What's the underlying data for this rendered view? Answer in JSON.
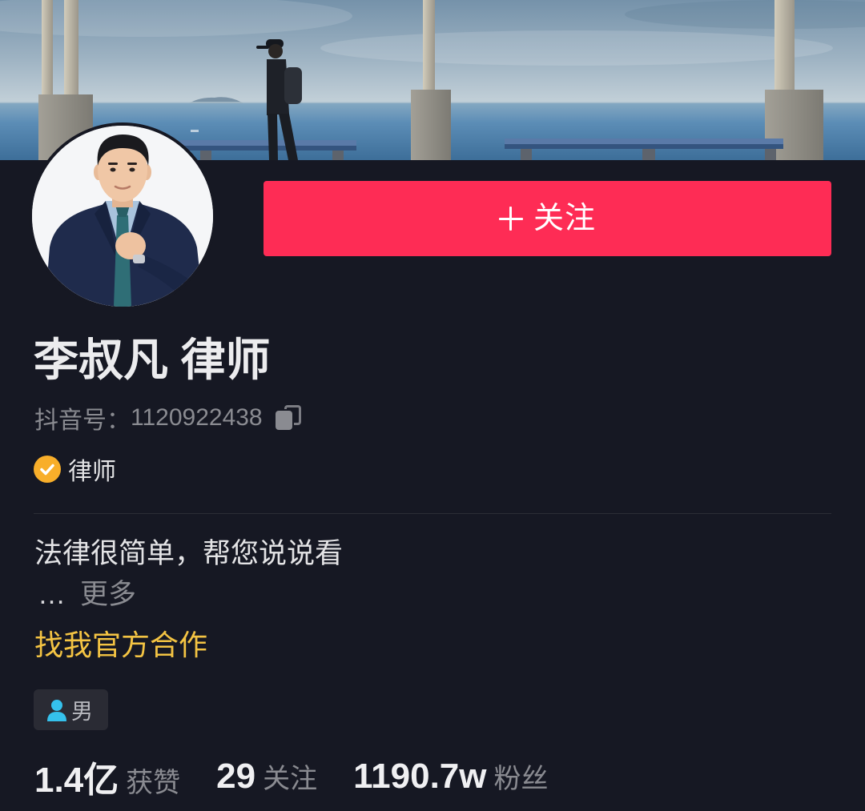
{
  "follow_button": {
    "label": "关注"
  },
  "profile": {
    "name": "李叔凡 律师",
    "douyin_id_label": "抖音号：",
    "douyin_id": "1120922438",
    "verified_label": "律师",
    "bio": "法律很简单，帮您说说看",
    "more_prefix": "…",
    "more_label": "更多",
    "business_link": "找我官方合作",
    "gender": "男"
  },
  "stats": [
    {
      "value": "1.4亿",
      "label": "获赞"
    },
    {
      "value": "29",
      "label": "关注"
    },
    {
      "value": "1190.7w",
      "label": "粉丝"
    }
  ],
  "icons": {
    "follow": "plus-icon",
    "copy": "copy-icon",
    "verified": "verified-check-icon",
    "gender": "male-user-icon"
  },
  "colors": {
    "background": "#161823",
    "follow_button": "#fe2c55",
    "business_link": "#f4c443",
    "verified_badge": "#f8ae2a",
    "gender_icon": "#35c1ec"
  }
}
